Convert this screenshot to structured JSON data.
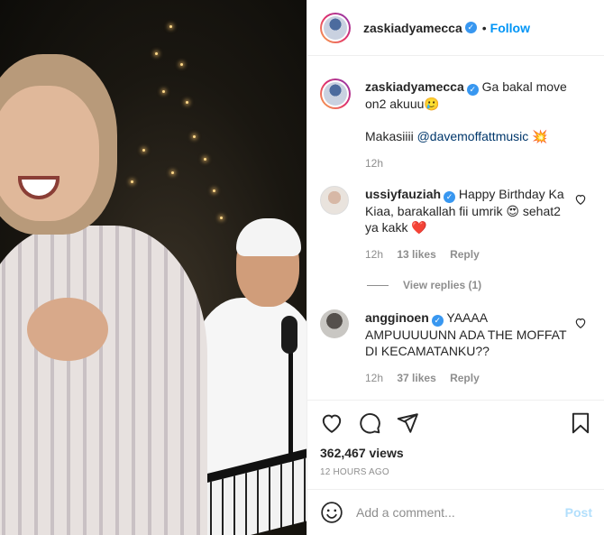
{
  "post_header": {
    "username": "zaskiadyamecca",
    "separator": "•",
    "follow_label": "Follow"
  },
  "caption": {
    "username": "zaskiadyamecca",
    "text_line1": "Ga bakal move on2 akuuu🥲",
    "text_line2_prefix": "Makasiiii ",
    "mention": "@davemoffattmusic",
    "emoji": "💥",
    "time": "12h"
  },
  "comments": [
    {
      "username": "ussiyfauziah",
      "text": "Happy Birthday Ka Kiaa, barakallah fii umrik 😍 sehat2 ya kakk ❤️",
      "time": "12h",
      "likes": "13 likes",
      "reply_label": "Reply",
      "view_replies": "View replies (1)"
    },
    {
      "username": "angginoen",
      "text": "YAAAA AMPUUUUUNN ADA THE MOFFAT DI KECAMATANKU??",
      "time": "12h",
      "likes": "37 likes",
      "reply_label": "Reply"
    }
  ],
  "stats": {
    "views": "362,467 views",
    "timestamp": "12 HOURS AGO"
  },
  "add_comment": {
    "placeholder": "Add a comment...",
    "post_label": "Post"
  },
  "icons": {
    "like": "heart-icon",
    "comment": "comment-bubble-icon",
    "share": "paper-plane-icon",
    "save": "bookmark-icon",
    "emoji": "smiley-icon",
    "verified": "verified-badge-icon"
  },
  "colors": {
    "link_blue": "#0095f6",
    "verified_blue": "#3897f0",
    "muted": "#8e8e8e",
    "post_disabled": "#b2dffc"
  }
}
